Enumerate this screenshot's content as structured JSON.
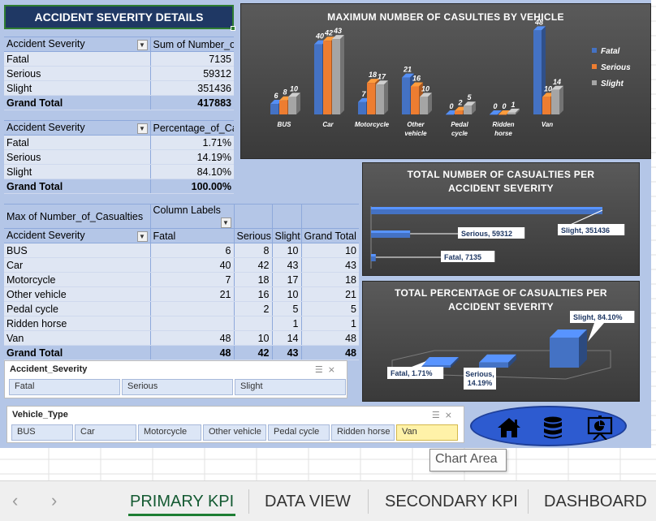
{
  "title": "ACCIDENT SEVERITY DETAILS",
  "pivot1": {
    "headers": [
      "Accident Severity",
      "Sum of Number_of_Casualties"
    ],
    "rows": [
      [
        "Fatal",
        "7135"
      ],
      [
        "Serious",
        "59312"
      ],
      [
        "Slight",
        "351436"
      ]
    ],
    "total": [
      "Grand Total",
      "417883"
    ]
  },
  "pivot2": {
    "headers": [
      "Accident Severity",
      "Percentage_of_Casualties"
    ],
    "rows": [
      [
        "Fatal",
        "1.71%"
      ],
      [
        "Serious",
        "14.19%"
      ],
      [
        "Slight",
        "84.10%"
      ]
    ],
    "total": [
      "Grand Total",
      "100.00%"
    ]
  },
  "pivot3": {
    "top": [
      "Max of Number_of_Casualties",
      "Column Labels"
    ],
    "headers": [
      "Accident Severity",
      "Fatal",
      "Serious",
      "Slight",
      "Grand Total"
    ],
    "rows": [
      [
        "BUS",
        "6",
        "8",
        "10",
        "10"
      ],
      [
        "Car",
        "40",
        "42",
        "43",
        "43"
      ],
      [
        "Motorcycle",
        "7",
        "18",
        "17",
        "18"
      ],
      [
        "Other vehicle",
        "21",
        "16",
        "10",
        "21"
      ],
      [
        "Pedal cycle",
        "",
        "2",
        "5",
        "5"
      ],
      [
        "Ridden horse",
        "",
        "",
        "1",
        "1"
      ],
      [
        "Van",
        "48",
        "10",
        "14",
        "48"
      ]
    ],
    "total": [
      "Grand Total",
      "48",
      "42",
      "43",
      "48"
    ]
  },
  "chart_data": [
    {
      "type": "bar",
      "title": "MAXIMUM NUMBER OF CASULTIES BY VEHICLE",
      "categories": [
        "BUS",
        "Car",
        "Motorcycle",
        "Other vehicle",
        "Pedal cycle",
        "Ridden horse",
        "Van"
      ],
      "series": [
        {
          "name": "Fatal",
          "values": [
            6,
            40,
            7,
            21,
            0,
            0,
            48
          ],
          "color": "#4472c4"
        },
        {
          "name": "Serious",
          "values": [
            8,
            42,
            18,
            16,
            2,
            0,
            10
          ],
          "color": "#ed7d31"
        },
        {
          "name": "Slight",
          "values": [
            10,
            43,
            17,
            10,
            5,
            1,
            14
          ],
          "color": "#a5a5a5"
        }
      ],
      "legend": "right",
      "ylim": [
        0,
        50
      ]
    },
    {
      "type": "bar",
      "title": "TOTAL NUMBER OF CASUALTIES PER ACCIDENT SEVERITY",
      "categories": [
        "Fatal",
        "Serious",
        "Slight"
      ],
      "values": [
        7135,
        59312,
        351436
      ],
      "data_labels": [
        "Fatal, 7135",
        "Serious, 59312",
        "Slight, 351436"
      ],
      "color": "#4472c4"
    },
    {
      "type": "bar",
      "title": "TOTAL PERCENTAGE OF CASUALTIES PER ACCIDENT SEVERITY",
      "categories": [
        "Fatal",
        "Serious",
        "Slight"
      ],
      "values": [
        1.71,
        14.19,
        84.1
      ],
      "data_labels": [
        "Fatal, 1.71%",
        "Serious, 14.19%",
        "Slight, 84.10%"
      ],
      "color": "#4472c4"
    }
  ],
  "slicer_severity": {
    "title": "Accident_Severity",
    "items": [
      "Fatal",
      "Serious",
      "Slight"
    ]
  },
  "slicer_vehicle": {
    "title": "Vehicle_Type",
    "items": [
      "BUS",
      "Car",
      "Motorcycle",
      "Other vehicle",
      "Pedal cycle",
      "Ridden horse",
      "Van"
    ],
    "selected": "Van"
  },
  "nav_icons": [
    "home-icon",
    "database-icon",
    "presentation-icon"
  ],
  "tooltip": "Chart Area",
  "tabs": [
    "PRIMARY KPI",
    "DATA VIEW",
    "SECONDARY KPI",
    "DASHBOARD"
  ],
  "active_tab": "PRIMARY KPI",
  "colors": {
    "header": "#1f3864",
    "accent": "#4472c4",
    "panel": "#b4c6e7",
    "active_tab": "#1e7e34"
  }
}
